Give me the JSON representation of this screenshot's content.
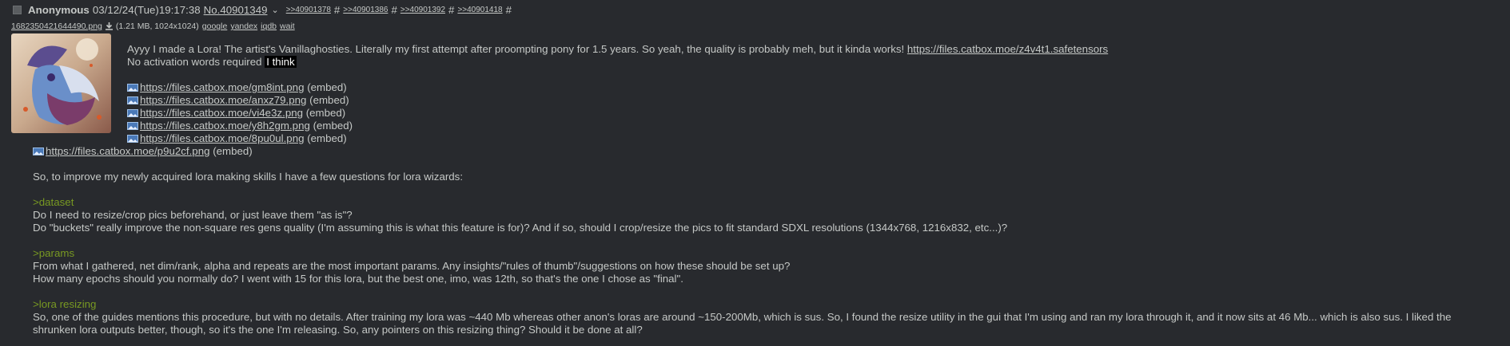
{
  "header": {
    "name": "Anonymous",
    "datetime": "03/12/24(Tue)19:17:38",
    "post_number": "No.40901349",
    "chevron": "⌄",
    "backlinks": [
      ">>40901378",
      ">>40901386",
      ">>40901392",
      ">>40901418"
    ],
    "hash": "#"
  },
  "file": {
    "filename": "1682350421644490.png",
    "meta": "(1.21 MB, 1024x1024)",
    "search_links": [
      "google",
      "yandex",
      "iqdb",
      "wait"
    ]
  },
  "message": {
    "intro_text": "Ayyy I made a Lora! The artist's Vanillaghosties. Literally my first attempt after proompting pony for 1.5 years. So yeah, the quality is probably meh, but it kinda works! ",
    "intro_link": "https://files.catbox.moe/z4v4t1.safetensors",
    "activation_text": "No activation words required ",
    "activation_spoiler": "I think",
    "embeds": [
      {
        "url": "https://files.catbox.moe/gm8int.png",
        "label": "(embed)"
      },
      {
        "url": "https://files.catbox.moe/anxz79.png",
        "label": "(embed)"
      },
      {
        "url": "https://files.catbox.moe/vi4e3z.png",
        "label": "(embed)"
      },
      {
        "url": "https://files.catbox.moe/y8h2gm.png",
        "label": "(embed)"
      },
      {
        "url": "https://files.catbox.moe/8pu0ul.png",
        "label": "(embed)"
      },
      {
        "url": "https://files.catbox.moe/p9u2cf.png",
        "label": "(embed)"
      }
    ],
    "questions_intro": "So, to improve my newly acquired lora making skills I have a few questions for lora wizards:",
    "dataset_quote": ">dataset",
    "dataset_q1": "Do I need to resize/crop pics beforehand, or just leave them \"as is\"?",
    "dataset_q2": "Do \"buckets\" really improve the non-square res gens quality (I'm assuming this is what this feature is for)? And if so, should I crop/resize the pics to fit standard SDXL resolutions (1344x768, 1216x832, etc...)?",
    "params_quote": ">params",
    "params_q1": "From what I gathered, net dim/rank, alpha and repeats are the most important params. Any insights/\"rules of thumb\"/suggestions on how these should be set up?",
    "params_q2": "How many epochs should you normally do? I went with 15 for this lora, but the best one, imo, was 12th, so that's the one I chose as \"final\".",
    "resize_quote": ">lora resizing",
    "resize_text": "So, one of the guides mentions this procedure, but with no details. After training my lora was ~440 Mb whereas other anon's loras are around ~150-200Mb, which is sus. So, I found the resize utility in the gui that I'm using and ran my lora through it, and it now sits at 46 Mb... which is also sus. I liked the shrunken lora outputs better, though, so it's the one I'm releasing. So, any pointers on this resizing thing? Should it be done at all?"
  },
  "colors": {
    "background": "#282a2e",
    "text": "#c5c8c6",
    "greentext": "#789922"
  }
}
